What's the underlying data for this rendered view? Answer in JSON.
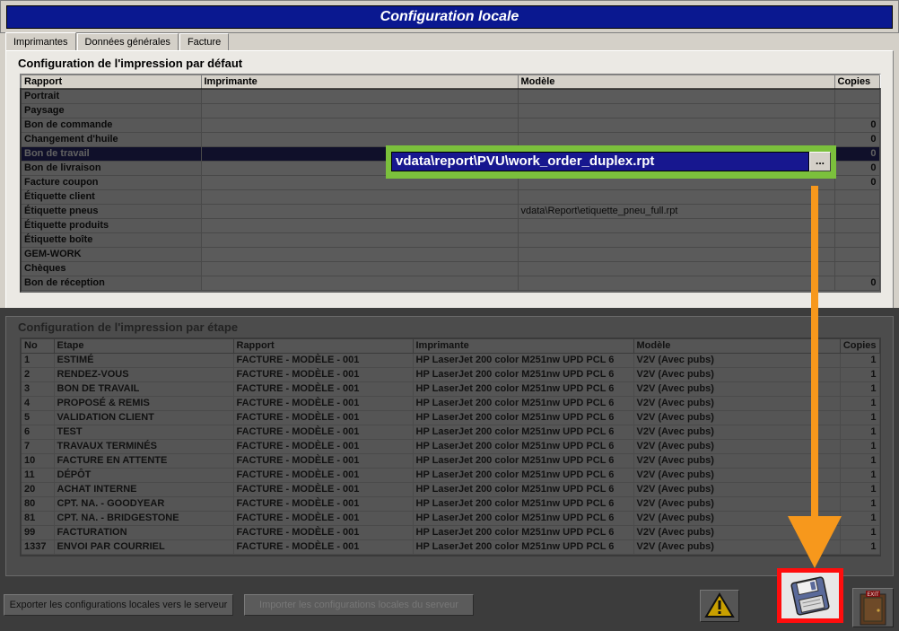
{
  "window": {
    "title": "Configuration locale"
  },
  "tabs": [
    {
      "label": "Imprimantes"
    },
    {
      "label": "Données générales"
    },
    {
      "label": "Facture"
    }
  ],
  "default_section": {
    "title": "Configuration de l'impression par défaut",
    "columns": [
      "Rapport",
      "Imprimante",
      "Modèle",
      "Copies"
    ],
    "rows": [
      {
        "rapport": "Portrait",
        "imprimante": "",
        "modele": "",
        "copies": ""
      },
      {
        "rapport": "Paysage",
        "imprimante": "",
        "modele": "",
        "copies": ""
      },
      {
        "rapport": "Bon de commande",
        "imprimante": "",
        "modele": "",
        "copies": "0"
      },
      {
        "rapport": "Changement d'huile",
        "imprimante": "",
        "modele": "",
        "copies": "0"
      },
      {
        "rapport": "Bon de travail",
        "imprimante": "",
        "modele": "",
        "copies": "0"
      },
      {
        "rapport": "Bon de livraison",
        "imprimante": "",
        "modele": "",
        "copies": "0"
      },
      {
        "rapport": "Facture coupon",
        "imprimante": "",
        "modele": "",
        "copies": "0"
      },
      {
        "rapport": "Étiquette client",
        "imprimante": "",
        "modele": "",
        "copies": ""
      },
      {
        "rapport": "Étiquette pneus",
        "imprimante": "",
        "modele": "vdata\\Report\\etiquette_pneu_full.rpt",
        "copies": ""
      },
      {
        "rapport": "Étiquette produits",
        "imprimante": "",
        "modele": "",
        "copies": ""
      },
      {
        "rapport": "Étiquette boîte",
        "imprimante": "",
        "modele": "",
        "copies": ""
      },
      {
        "rapport": "GEM-WORK",
        "imprimante": "",
        "modele": "",
        "copies": ""
      },
      {
        "rapport": "Chèques",
        "imprimante": "",
        "modele": "",
        "copies": ""
      },
      {
        "rapport": "Bon de réception",
        "imprimante": "",
        "modele": "",
        "copies": "0"
      }
    ],
    "editor": {
      "value": "vdata\\report\\PVU\\work_order_duplex.rpt",
      "browse_label": "..."
    }
  },
  "step_section": {
    "title": "Configuration de l'impression par étape",
    "columns": [
      "No",
      "Etape",
      "Rapport",
      "Imprimante",
      "Modèle",
      "Copies"
    ],
    "rows": [
      {
        "no": "1",
        "etape": "ESTIMÉ",
        "rapport": "FACTURE - MODÈLE - 001",
        "imprimante": "HP LaserJet 200 color M251nw UPD PCL 6",
        "modele": "V2V (Avec pubs)",
        "copies": "1"
      },
      {
        "no": "2",
        "etape": "RENDEZ-VOUS",
        "rapport": "FACTURE - MODÈLE - 001",
        "imprimante": "HP LaserJet 200 color M251nw UPD PCL 6",
        "modele": "V2V (Avec pubs)",
        "copies": "1"
      },
      {
        "no": "3",
        "etape": "BON DE TRAVAIL",
        "rapport": "FACTURE - MODÈLE - 001",
        "imprimante": "HP LaserJet 200 color M251nw UPD PCL 6",
        "modele": "V2V (Avec pubs)",
        "copies": "1"
      },
      {
        "no": "4",
        "etape": "PROPOSÉ & REMIS",
        "rapport": "FACTURE - MODÈLE - 001",
        "imprimante": "HP LaserJet 200 color M251nw UPD PCL 6",
        "modele": "V2V (Avec pubs)",
        "copies": "1"
      },
      {
        "no": "5",
        "etape": "VALIDATION CLIENT",
        "rapport": "FACTURE - MODÈLE - 001",
        "imprimante": "HP LaserJet 200 color M251nw UPD PCL 6",
        "modele": "V2V (Avec pubs)",
        "copies": "1"
      },
      {
        "no": "6",
        "etape": "TEST",
        "rapport": "FACTURE - MODÈLE - 001",
        "imprimante": "HP LaserJet 200 color M251nw UPD PCL 6",
        "modele": "V2V (Avec pubs)",
        "copies": "1"
      },
      {
        "no": "7",
        "etape": "TRAVAUX TERMINÉS",
        "rapport": "FACTURE - MODÈLE - 001",
        "imprimante": "HP LaserJet 200 color M251nw UPD PCL 6",
        "modele": "V2V (Avec pubs)",
        "copies": "1"
      },
      {
        "no": "10",
        "etape": "FACTURE EN ATTENTE",
        "rapport": "FACTURE - MODÈLE - 001",
        "imprimante": "HP LaserJet 200 color M251nw UPD PCL 6",
        "modele": "V2V (Avec pubs)",
        "copies": "1"
      },
      {
        "no": "11",
        "etape": "DÉPÔT",
        "rapport": "FACTURE - MODÈLE - 001",
        "imprimante": "HP LaserJet 200 color M251nw UPD PCL 6",
        "modele": "V2V (Avec pubs)",
        "copies": "1"
      },
      {
        "no": "20",
        "etape": "ACHAT INTERNE",
        "rapport": "FACTURE - MODÈLE - 001",
        "imprimante": "HP LaserJet 200 color M251nw UPD PCL 6",
        "modele": "V2V (Avec pubs)",
        "copies": "1"
      },
      {
        "no": "80",
        "etape": "CPT. NA. - GOODYEAR",
        "rapport": "FACTURE - MODÈLE - 001",
        "imprimante": "HP LaserJet 200 color M251nw UPD PCL 6",
        "modele": "V2V (Avec pubs)",
        "copies": "1"
      },
      {
        "no": "81",
        "etape": "CPT. NA. - BRIDGESTONE",
        "rapport": "FACTURE - MODÈLE - 001",
        "imprimante": "HP LaserJet 200 color M251nw UPD PCL 6",
        "modele": "V2V (Avec pubs)",
        "copies": "1"
      },
      {
        "no": "99",
        "etape": "FACTURATION",
        "rapport": "FACTURE - MODÈLE - 001",
        "imprimante": "HP LaserJet 200 color M251nw UPD PCL 6",
        "modele": "V2V (Avec pubs)",
        "copies": "1"
      },
      {
        "no": "1337",
        "etape": "ENVOI PAR COURRIEL",
        "rapport": "FACTURE - MODÈLE - 001",
        "imprimante": "HP LaserJet 200 color M251nw UPD PCL 6",
        "modele": "V2V (Avec pubs)",
        "copies": "1"
      }
    ]
  },
  "footer": {
    "export_label": "Exporter les configurations locales vers le serveur",
    "import_label": "Importer les configurations locales du serveur",
    "warning_icon": "warning-icon",
    "save_icon": "floppy-disk-icon",
    "exit_icon": "exit-door-icon",
    "exit_label": "EXIT"
  },
  "colors": {
    "title_bg": "#0a1890",
    "selected_row": "#2a2a6e",
    "editor_frame": "#7bc03c",
    "arrow": "#f7981c",
    "save_highlight": "#ff0d0d"
  }
}
